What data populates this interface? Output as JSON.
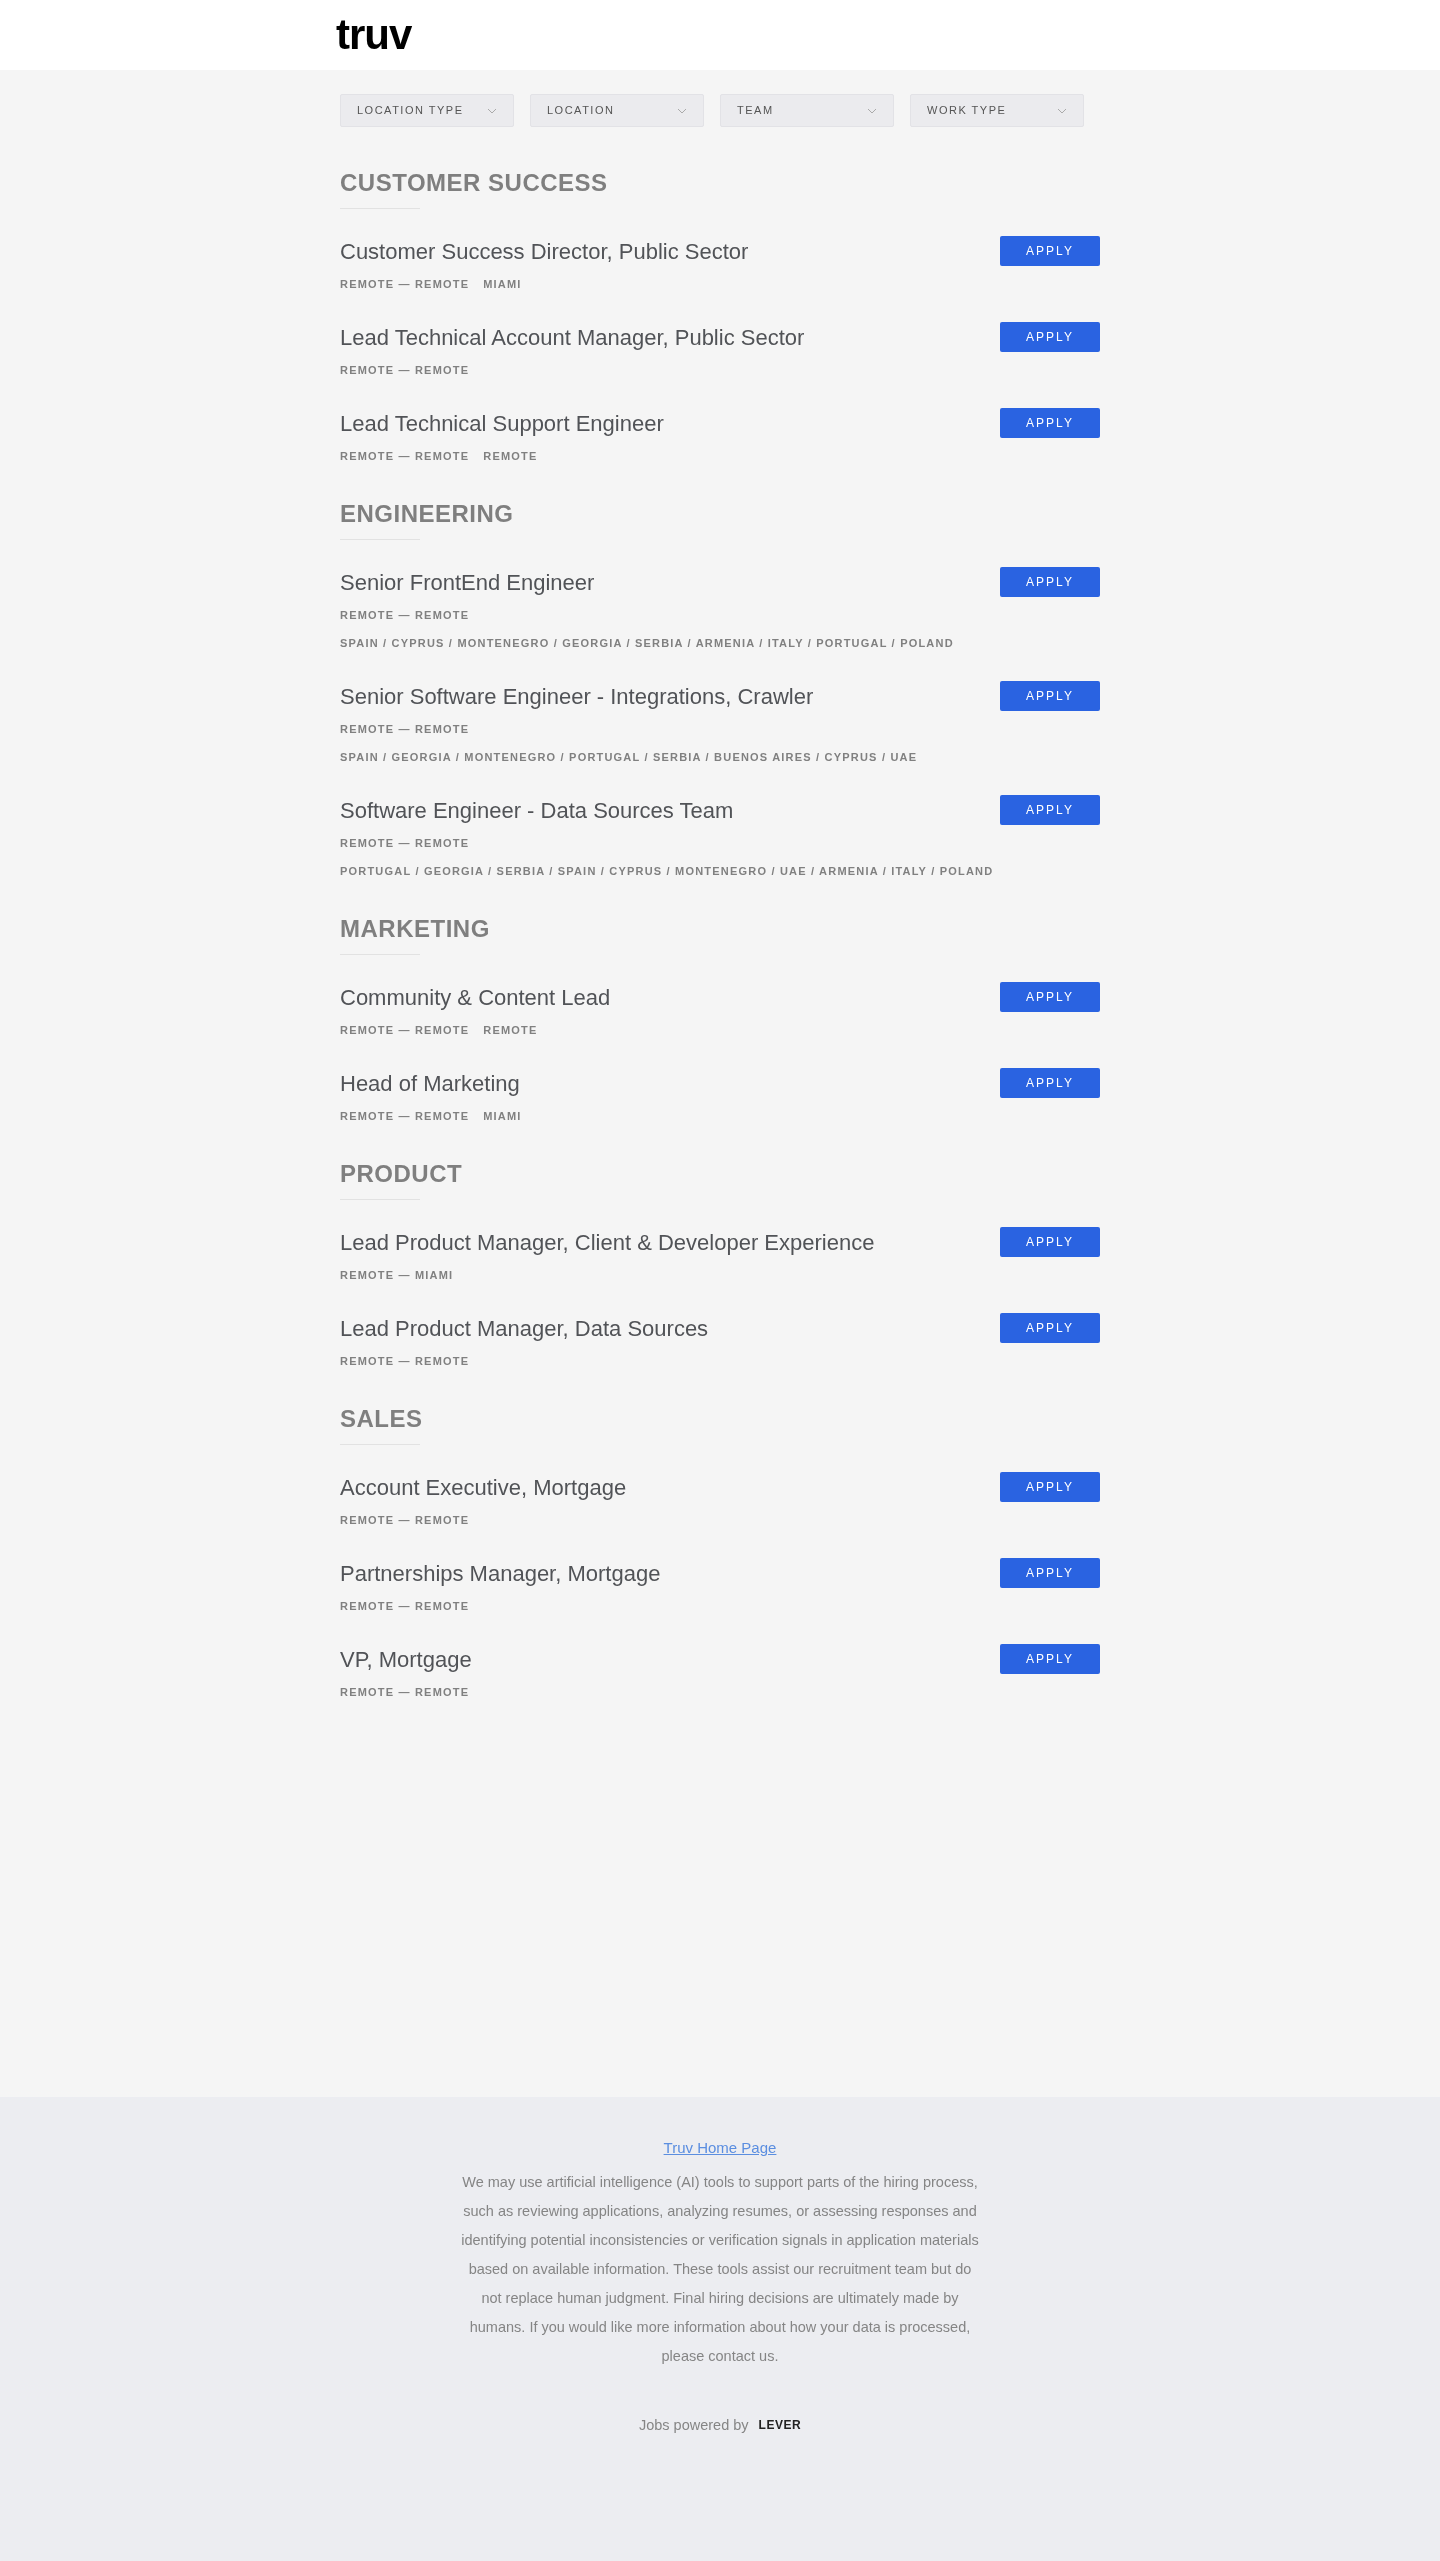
{
  "header": {
    "logo": "truv"
  },
  "filters": [
    {
      "label": "LOCATION TYPE"
    },
    {
      "label": "LOCATION"
    },
    {
      "label": "TEAM"
    },
    {
      "label": "WORK TYPE"
    }
  ],
  "sections": [
    {
      "title": "CUSTOMER SUCCESS",
      "jobs": [
        {
          "title": "Customer Success Director, Public Sector",
          "tags": [
            "REMOTE — REMOTE",
            "MIAMI"
          ],
          "button": "APPLY"
        },
        {
          "title": "Lead Technical Account Manager, Public Sector",
          "tags": [
            "REMOTE — REMOTE"
          ],
          "button": "APPLY"
        },
        {
          "title": "Lead Technical Support Engineer",
          "tags": [
            "REMOTE — REMOTE",
            "REMOTE"
          ],
          "button": "APPLY"
        }
      ]
    },
    {
      "title": "ENGINEERING",
      "jobs": [
        {
          "title": "Senior FrontEnd Engineer",
          "tags": [
            "REMOTE — REMOTE",
            "SPAIN / CYPRUS / MONTENEGRO / GEORGIA / SERBIA / ARMENIA / ITALY / PORTUGAL / POLAND"
          ],
          "button": "APPLY"
        },
        {
          "title": "Senior Software Engineer - Integrations, Crawler",
          "tags": [
            "REMOTE — REMOTE",
            "SPAIN / GEORGIA / MONTENEGRO / PORTUGAL / SERBIA / BUENOS AIRES / CYPRUS / UAE"
          ],
          "button": "APPLY"
        },
        {
          "title": "Software Engineer - Data Sources Team",
          "tags": [
            "REMOTE — REMOTE",
            "PORTUGAL / GEORGIA / SERBIA / SPAIN / CYPRUS / MONTENEGRO / UAE / ARMENIA / ITALY / POLAND"
          ],
          "button": "APPLY"
        }
      ]
    },
    {
      "title": "MARKETING",
      "jobs": [
        {
          "title": "Community & Content Lead",
          "tags": [
            "REMOTE — REMOTE",
            "REMOTE"
          ],
          "button": "APPLY"
        },
        {
          "title": "Head of Marketing",
          "tags": [
            "REMOTE — REMOTE",
            "MIAMI"
          ],
          "button": "APPLY"
        }
      ]
    },
    {
      "title": "PRODUCT",
      "jobs": [
        {
          "title": "Lead Product Manager, Client & Developer Experience",
          "tags": [
            "REMOTE — MIAMI"
          ],
          "button": "APPLY"
        },
        {
          "title": "Lead Product Manager, Data Sources",
          "tags": [
            "REMOTE — REMOTE"
          ],
          "button": "APPLY"
        }
      ]
    },
    {
      "title": "SALES",
      "jobs": [
        {
          "title": "Account Executive, Mortgage",
          "tags": [
            "REMOTE — REMOTE"
          ],
          "button": "APPLY"
        },
        {
          "title": "Partnerships Manager, Mortgage",
          "tags": [
            "REMOTE — REMOTE"
          ],
          "button": "APPLY"
        },
        {
          "title": "VP, Mortgage",
          "tags": [
            "REMOTE — REMOTE"
          ],
          "button": "APPLY"
        }
      ]
    }
  ],
  "footer": {
    "link": "Truv Home Page",
    "notice": "We may use artificial intelligence (AI) tools to support parts of the hiring process, such as reviewing applications, analyzing resumes, or assessing responses and identifying potential inconsistencies or verification signals in application materials based on available information. These tools assist our recruitment team but do not replace human judgment. Final hiring decisions are ultimately made by humans. If you would like more information about how your data is processed, please contact us.",
    "powered_by": "Jobs powered by",
    "brand": "LEVER"
  }
}
